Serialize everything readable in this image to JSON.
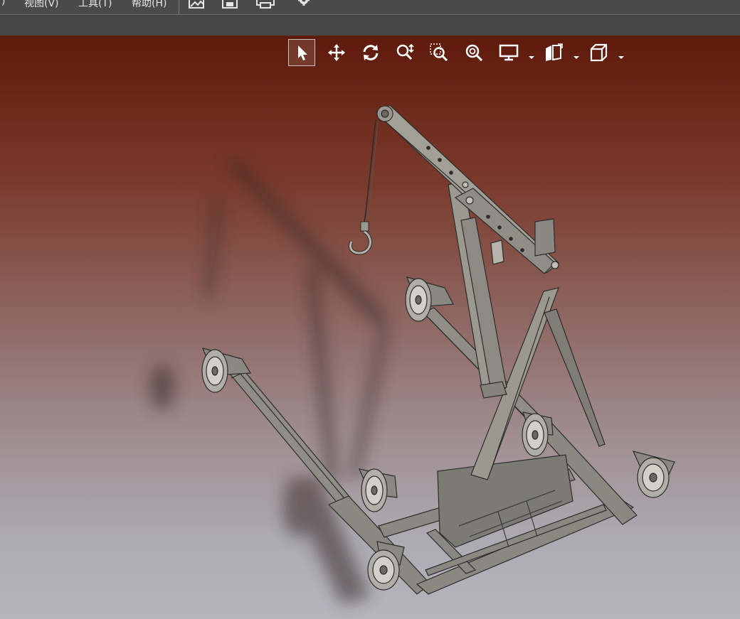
{
  "menubar": {
    "items": [
      {
        "label": ")"
      },
      {
        "label": "视图(V)"
      },
      {
        "label": "工具(T)"
      },
      {
        "label": "帮助(H)"
      }
    ],
    "quick_access": [
      "picture-icon",
      "save-icon",
      "print-icon",
      "settings-gear-icon"
    ]
  },
  "view_toolbar": {
    "tools": [
      {
        "name": "select-arrow-icon",
        "active": true
      },
      {
        "name": "pan-move-icon"
      },
      {
        "name": "rotate-icon"
      },
      {
        "name": "zoom-in-out-icon"
      },
      {
        "name": "zoom-window-icon"
      },
      {
        "name": "zoom-fit-icon"
      },
      {
        "name": "display-mode-monitor-icon",
        "dropdown": true
      },
      {
        "name": "section-view-icon",
        "dropdown": true
      },
      {
        "name": "standard-view-cube-icon",
        "dropdown": true
      }
    ]
  },
  "colors": {
    "viewport_top": "#5e1a0b",
    "viewport_bottom": "#b6b5bd",
    "toolbar_icon": "#ffffff",
    "model_steel": "#8f8d85"
  }
}
